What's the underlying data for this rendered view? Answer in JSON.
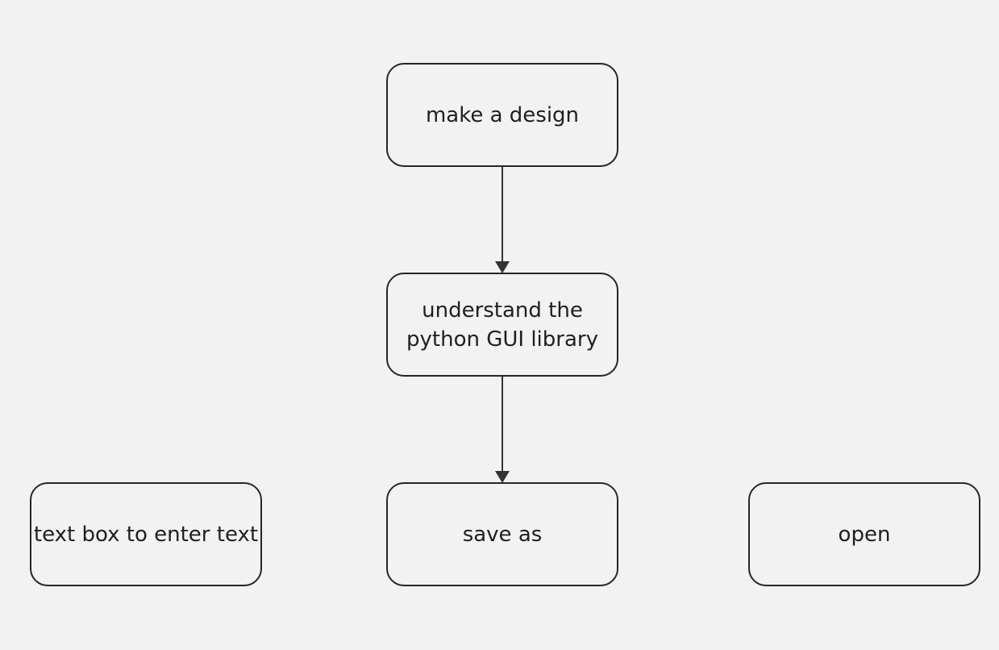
{
  "nodes": {
    "design": "make a design",
    "library": "understand the\npython GUI library",
    "textbox": "text box to enter text",
    "saveas": "save as",
    "open": "open"
  },
  "edges": [
    {
      "from": "make a design",
      "to": "understand the python GUI library"
    },
    {
      "from": "understand the python GUI library",
      "to": "save as"
    }
  ],
  "colors": {
    "background": "#f2f2f2",
    "stroke": "#262626",
    "text": "#1f1f1f"
  }
}
